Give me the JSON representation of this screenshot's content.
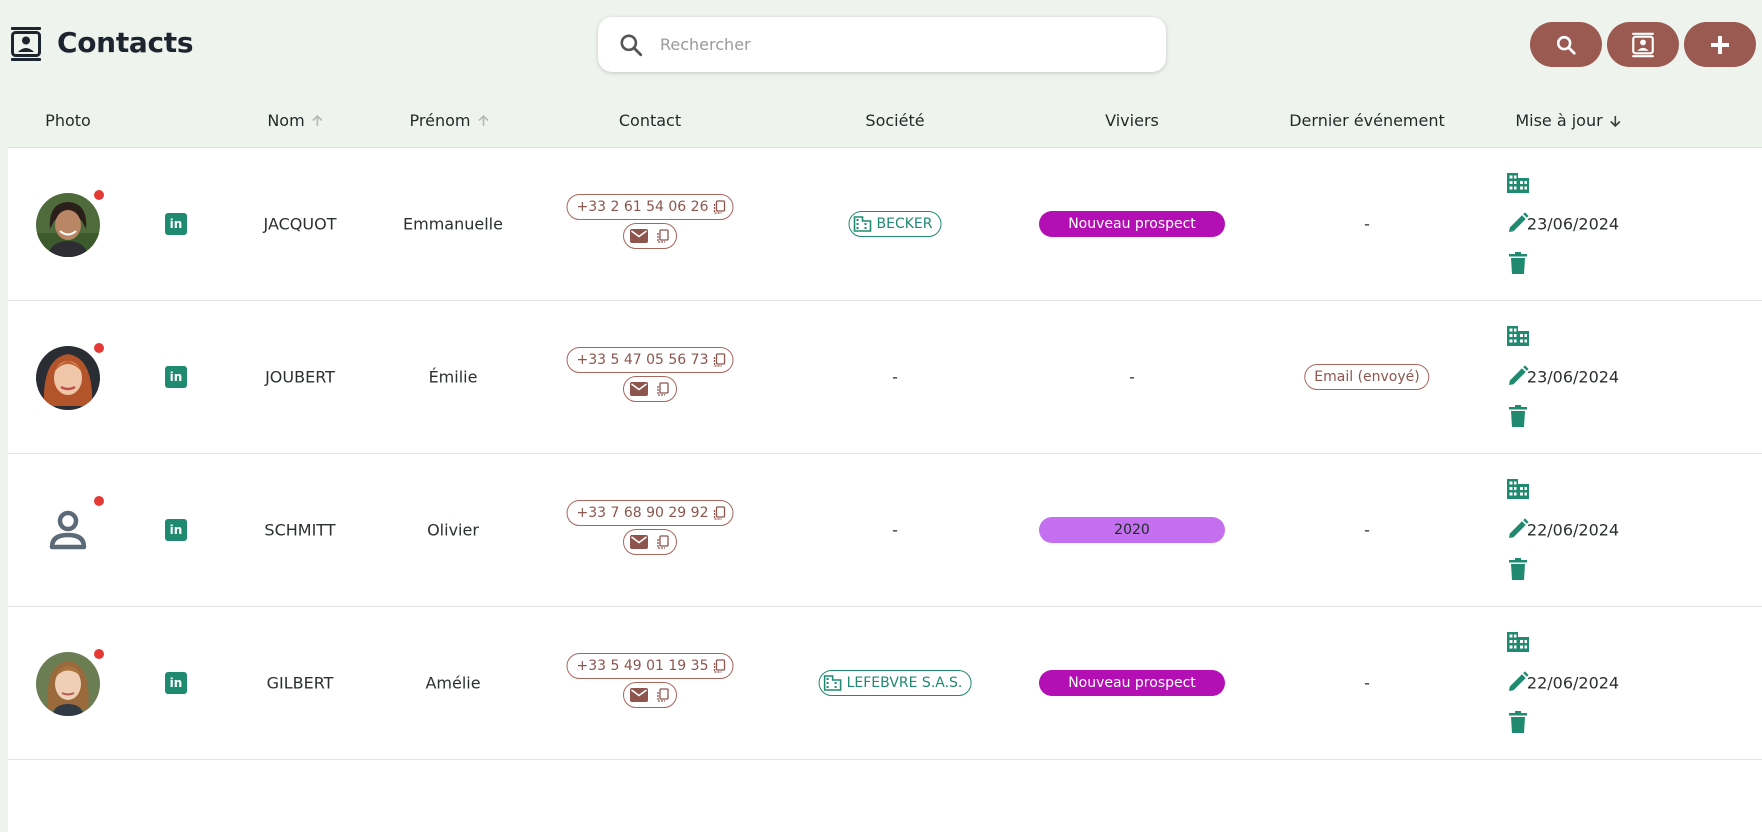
{
  "header": {
    "title": "Contacts",
    "search_placeholder": "Rechercher",
    "search_value": ""
  },
  "colors": {
    "accent": "#9a5a52",
    "teal": "#1f8a70",
    "magenta": "#b40fb5",
    "violet": "#c46ef0",
    "alert": "#e53935"
  },
  "columns": {
    "photo": "Photo",
    "nom": "Nom",
    "prenom": "Prénom",
    "contact": "Contact",
    "societe": "Société",
    "viviers": "Viviers",
    "dernier": "Dernier événement",
    "maj": "Mise à jour"
  },
  "rows": [
    {
      "nom": "JACQUOT",
      "prenom": "Emmanuelle",
      "phone": "+33 2 61 54 06 26",
      "company": "BECKER",
      "company_text": "",
      "vivier": "Nouveau prospect",
      "vivier_color": "#b40fb5",
      "vivier_text": "",
      "event": "",
      "event_text": "-",
      "updated": "23/06/2024",
      "avatar": "photo-woman-dark-hair"
    },
    {
      "nom": "JOUBERT",
      "prenom": "Émilie",
      "phone": "+33 5 47 05 56 73",
      "company": "",
      "company_text": "-",
      "vivier": "",
      "vivier_color": "",
      "vivier_text": "-",
      "event": "Email (envoyé)",
      "event_text": "",
      "updated": "23/06/2024",
      "avatar": "photo-woman-red-hair"
    },
    {
      "nom": "SCHMITT",
      "prenom": "Olivier",
      "phone": "+33 7 68 90 29 92",
      "company": "",
      "company_text": "-",
      "vivier": "2020",
      "vivier_color": "#c46ef0",
      "vivier_text": "",
      "event": "",
      "event_text": "-",
      "updated": "22/06/2024",
      "avatar": "placeholder-person-icon"
    },
    {
      "nom": "GILBERT",
      "prenom": "Amélie",
      "phone": "+33 5 49 01 19 35",
      "company": "LEFEBVRE S.A.S.",
      "company_text": "",
      "vivier": "Nouveau prospect",
      "vivier_color": "#b40fb5",
      "vivier_text": "",
      "event": "",
      "event_text": "-",
      "updated": "22/06/2024",
      "avatar": "photo-woman-light-hair"
    }
  ]
}
